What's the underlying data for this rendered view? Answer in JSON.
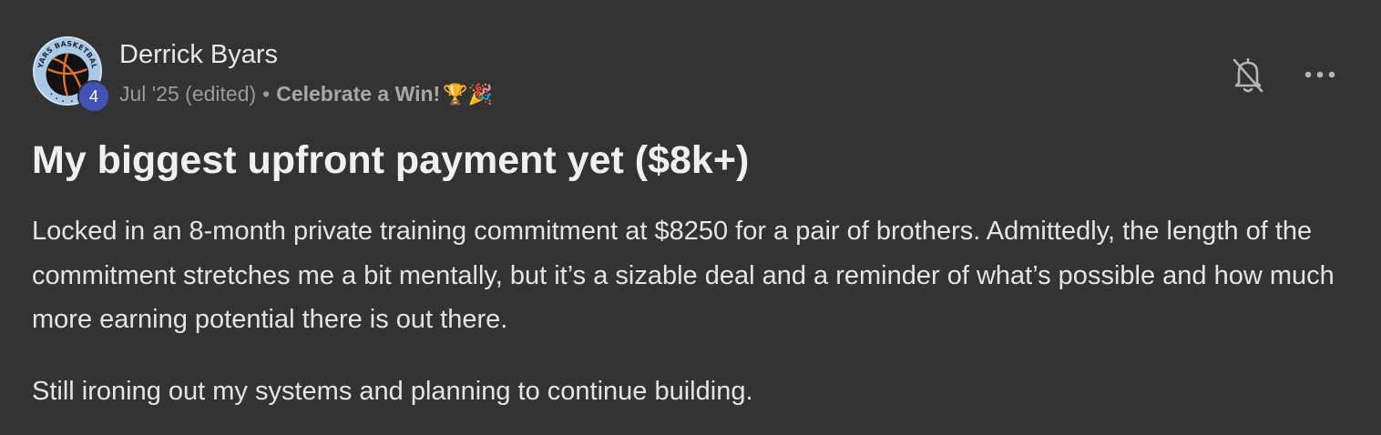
{
  "author": {
    "name": "Derrick Byars",
    "avatar_text": "BYARS BASKETBALL",
    "level": "4"
  },
  "meta": {
    "date": "Jul '25 (edited)",
    "separator": "•",
    "category": "Celebrate a Win!",
    "category_emoji": "🏆🎉"
  },
  "actions": {
    "notify_icon": "bell-slash-icon",
    "more_icon": "ellipsis-icon"
  },
  "post": {
    "title": "My biggest upfront payment yet ($8k+)",
    "paragraphs": [
      "Locked in an 8-month private training commitment at $8250 for a pair of brothers. Admittedly, the length of the commitment stretches me a bit mentally, but it’s a sizable deal and a reminder of what’s possible and how much more earning potential there is out there.",
      "Still ironing out my systems and planning to continue building."
    ]
  },
  "colors": {
    "background": "#333333",
    "badge": "#4352b5",
    "avatar_ring": "#a9c9e4",
    "ball": "#e8731f"
  }
}
